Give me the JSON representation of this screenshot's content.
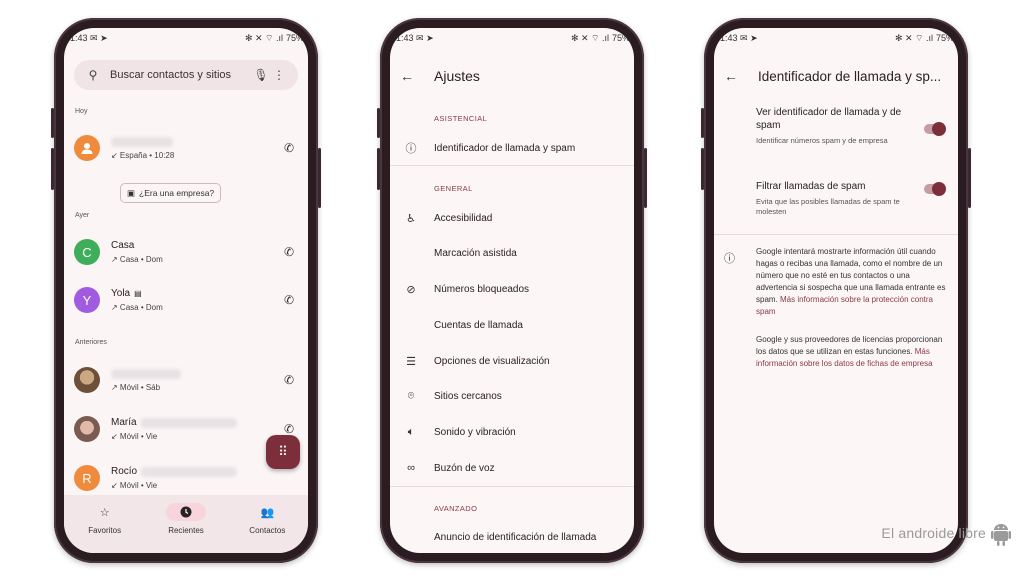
{
  "status": {
    "time": "1:43",
    "icons": "✉ ➤",
    "right": "✻ ✕ ⌔ .ıl",
    "battery": "75%"
  },
  "phone1": {
    "search": {
      "placeholder": "Buscar contactos y sitios"
    },
    "sections": {
      "today": "Hoy",
      "yesterday": "Ayer",
      "older": "Anteriores"
    },
    "calls": [
      {
        "name": "",
        "sub": "↙ España • 10:28",
        "avatar_letter": "",
        "avatar_color": "#f08a3c"
      },
      {
        "name": "Casa",
        "sub": "↗ Casa • Dom",
        "avatar_letter": "C",
        "avatar_color": "#3fae5a"
      },
      {
        "name": "Yola",
        "sub": "↗ Casa • Dom",
        "avatar_letter": "Y",
        "avatar_color": "#a05be0"
      },
      {
        "name": "",
        "sub": "↗ Móvil • Sáb",
        "avatar_letter": "",
        "avatar_color": "#8a6a4f"
      },
      {
        "name": "María",
        "sub": "↙ Móvil • Vie",
        "avatar_letter": "",
        "avatar_color": "#b08a7a"
      },
      {
        "name": "Rocío",
        "sub": "↙ Móvil • Vie",
        "avatar_letter": "R",
        "avatar_color": "#f08a3c"
      }
    ],
    "chip_label": "¿Era una empresa?",
    "nav": {
      "favorites": "Favoritos",
      "recents": "Recientes",
      "contacts": "Contactos"
    }
  },
  "phone2": {
    "title": "Ajustes",
    "section_asistencial": "ASISTENCIAL",
    "section_general": "GENERAL",
    "section_avanzado": "AVANZADO",
    "items": [
      "Identificador de llamada y spam",
      "Accesibilidad",
      "Marcación asistida",
      "Números bloqueados",
      "Cuentas de llamada",
      "Opciones de visualización",
      "Sitios cercanos",
      "Sonido y vibración",
      "Buzón de voz",
      "Anuncio de identificación de llamada"
    ]
  },
  "phone3": {
    "title": "Identificador de llamada y sp...",
    "toggle1": {
      "title": "Ver identificador de llamada y de spam",
      "desc": "Identificar números spam y de empresa",
      "on": true
    },
    "toggle2": {
      "title": "Filtrar llamadas de spam",
      "desc": "Evita que las posibles llamadas de spam te molesten",
      "on": true
    },
    "info1_text": "Google intentará mostrarte información útil cuando hagas o recibas una llamada, como el nombre de un número que no esté en tus contactos o una advertencia si sospecha que una llamada entrante es spam. ",
    "info1_link": "Más información sobre la protección contra spam",
    "info2_text": "Google y sus proveedores de licencias proporcionan los datos que se utilizan en estas funciones. ",
    "info2_link": "Más información sobre los datos de fichas de empresa"
  },
  "watermark": "El androide libre",
  "colors": {
    "accent": "#7c2e3b",
    "link": "#8b3a47",
    "surface": "#fbf5f6"
  }
}
